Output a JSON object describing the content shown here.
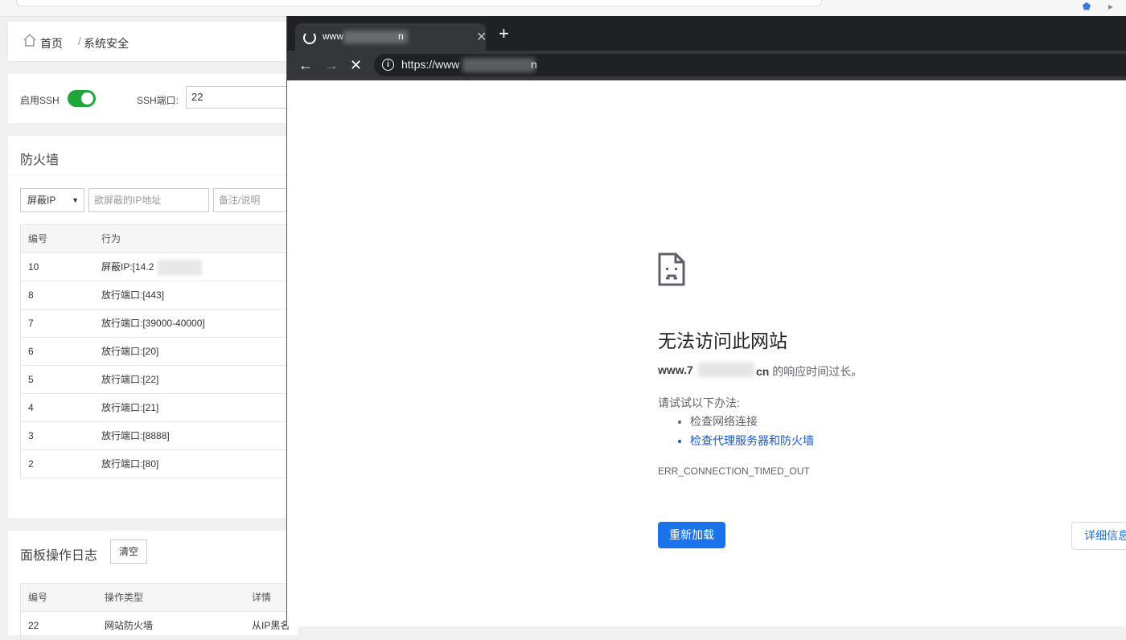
{
  "panel": {
    "breadcrumb": {
      "home": "首页",
      "sep": "/",
      "current": "系统安全"
    },
    "ssh": {
      "enable_label": "启用SSH",
      "enabled": true,
      "port_label": "SSH端口:",
      "port_value": "22"
    },
    "firewall": {
      "title": "防火墙",
      "select_value": "屏蔽IP",
      "ip_placeholder": "欲屏蔽的IP地址",
      "note_placeholder": "备注/说明",
      "columns": [
        "编号",
        "行为"
      ],
      "rows": [
        {
          "id": "10",
          "action": "屏蔽IP:[14.2"
        },
        {
          "id": "8",
          "action": "放行端口:[443]"
        },
        {
          "id": "7",
          "action": "放行端口:[39000-40000]"
        },
        {
          "id": "6",
          "action": "放行端口:[20]"
        },
        {
          "id": "5",
          "action": "放行端口:[22]"
        },
        {
          "id": "4",
          "action": "放行端口:[21]"
        },
        {
          "id": "3",
          "action": "放行端口:[8888]"
        },
        {
          "id": "2",
          "action": "放行端口:[80]"
        }
      ]
    },
    "log": {
      "title": "面板操作日志",
      "clear_label": "清空",
      "columns": [
        "编号",
        "操作类型",
        "详情"
      ],
      "rows": [
        {
          "id": "22",
          "type": "网站防火墙",
          "detail": "从IP黑名"
        }
      ]
    }
  },
  "browser": {
    "tab_title": "www",
    "tab_suffix": "n",
    "url": "https://www",
    "url_suffix": "n",
    "error": {
      "title": "无法访问此网站",
      "host": "www.7",
      "host_suffix": "cn",
      "host_message": " 的响应时间过长。",
      "try_label": "请试试以下办法:",
      "suggestions": [
        "检查网络连接",
        "检查代理服务器和防火墙"
      ],
      "code": "ERR_CONNECTION_TIMED_OUT",
      "reload_label": "重新加载",
      "details_label": "详细信息"
    }
  },
  "colors": {
    "toggle_on": "#20a53a",
    "reload_button": "#1a73e8",
    "link": "#1558d6"
  }
}
